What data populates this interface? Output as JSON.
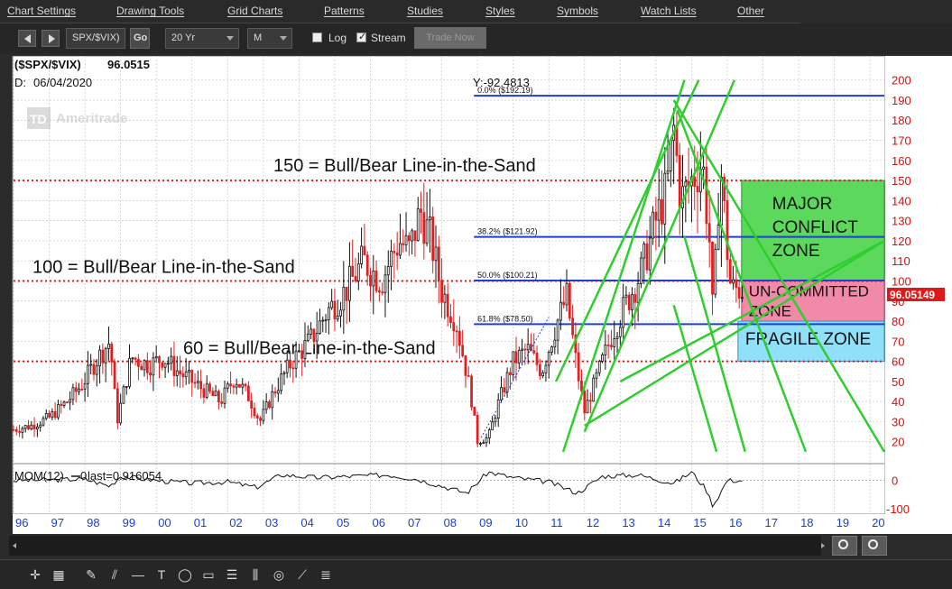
{
  "menu": [
    "Chart Settings",
    "Drawing Tools",
    "Grid Charts",
    "Patterns",
    "Studies",
    "Styles",
    "Symbols",
    "Watch Lists",
    "Other"
  ],
  "toolbar": {
    "symbol": "SPX/$VIX)",
    "go_label": "Go",
    "range": "20 Yr",
    "interval": "M",
    "log_label": "Log",
    "log_checked": false,
    "stream_label": "Stream",
    "stream_checked": true,
    "trade_now_label": "Trade Now"
  },
  "chart_header": {
    "title": "($SPX/$VIX)",
    "last_value": "96.0515",
    "date_label": "D:",
    "date": "06/04/2020",
    "y_readout": "Y:-92.4813",
    "watermark": "Ameritrade",
    "watermark_badge": "TD"
  },
  "chart_data": {
    "type": "line",
    "title": "($SPX/$VIX)",
    "x_ticks": [
      "96",
      "97",
      "98",
      "99",
      "00",
      "01",
      "02",
      "03",
      "04",
      "05",
      "06",
      "07",
      "08",
      "09",
      "10",
      "11",
      "12",
      "13",
      "14",
      "15",
      "16",
      "17",
      "18",
      "19",
      "20"
    ],
    "x_tick_years": [
      1996,
      1997,
      1998,
      1999,
      2000,
      2001,
      2002,
      2003,
      2004,
      2005,
      2006,
      2007,
      2008,
      2009,
      2010,
      2011,
      2012,
      2013,
      2014,
      2015,
      2016,
      2017,
      2018,
      2019,
      2020
    ],
    "y_ticks": [
      20,
      30,
      40,
      50,
      60,
      70,
      80,
      90,
      100,
      110,
      120,
      130,
      140,
      150,
      160,
      170,
      180,
      190,
      200
    ],
    "ylim": [
      10,
      203
    ],
    "xlim": [
      1996.0,
      2020.4
    ],
    "last_value_label": "96.05149",
    "price_series": {
      "name": "$SPX/$VIX",
      "x": [
        1996.0,
        1996.5,
        1997.0,
        1997.5,
        1997.9,
        1998.3,
        1998.7,
        1998.9,
        1999.3,
        1999.8,
        2000.2,
        2000.6,
        2001.0,
        2001.4,
        2001.8,
        2002.2,
        2002.6,
        2002.9,
        2003.3,
        2003.8,
        2004.3,
        2004.8,
        2005.3,
        2005.8,
        2006.3,
        2006.8,
        2007.1,
        2007.4,
        2007.7,
        2008.0,
        2008.4,
        2008.8,
        2009.0,
        2009.3,
        2009.6,
        2010.0,
        2010.4,
        2010.8,
        2011.2,
        2011.5,
        2011.8,
        2012.0,
        2012.4,
        2012.8,
        2013.2,
        2013.6,
        2014.0,
        2014.3,
        2014.5,
        2014.7,
        2015.0,
        2015.3,
        2015.5,
        2015.6,
        2015.8,
        2016.0,
        2016.1
      ],
      "y": [
        26,
        28,
        32,
        40,
        48,
        60,
        70,
        30,
        62,
        58,
        62,
        55,
        50,
        45,
        40,
        52,
        42,
        30,
        45,
        60,
        70,
        85,
        95,
        110,
        100,
        120,
        115,
        135,
        120,
        95,
        80,
        45,
        20,
        22,
        40,
        60,
        66,
        55,
        78,
        92,
        55,
        35,
        55,
        75,
        90,
        105,
        130,
        145,
        175,
        140,
        150,
        160,
        120,
        80,
        160,
        115,
        96
      ]
    },
    "momentum": {
      "label": "MOM(12)",
      "last_label": "last=0.916054",
      "y_ticks": [
        0,
        -100
      ],
      "x": [
        1996.0,
        1997.0,
        1998.0,
        1998.7,
        1999.0,
        2000.0,
        2001.0,
        2002.0,
        2002.8,
        2003.5,
        2004.5,
        2005.5,
        2006.5,
        2007.3,
        2008.0,
        2008.7,
        2009.3,
        2010.0,
        2011.0,
        2011.8,
        2012.5,
        2013.5,
        2014.5,
        2015.0,
        2015.4,
        2015.6,
        2016.0
      ],
      "y": [
        0,
        2,
        5,
        -20,
        15,
        0,
        -10,
        -5,
        -25,
        20,
        10,
        15,
        20,
        5,
        -20,
        -45,
        30,
        10,
        -5,
        -45,
        15,
        20,
        -10,
        30,
        -30,
        -90,
        0
      ]
    },
    "fib_levels": [
      {
        "label": "0.0%",
        "value_label": "($192.19)",
        "y": 192.19
      },
      {
        "label": "38.2%",
        "value_label": "($121.92)",
        "y": 121.92
      },
      {
        "label": "50.0%",
        "value_label": "($100.21)",
        "y": 100.21
      },
      {
        "label": "61.8%",
        "value_label": "($78.50)",
        "y": 78.5
      }
    ],
    "hlines": [
      {
        "y": 150,
        "label": "150 = Bull/Bear Line-in-the-Sand",
        "color": "#d42020"
      },
      {
        "y": 100,
        "label": "100 = Bull/Bear Line-in-the-Sand",
        "color": "#d42020"
      },
      {
        "y": 60,
        "label": "60 = Bull/Bear Line-in-the-Sand",
        "color": "#d42020"
      }
    ],
    "zones": [
      {
        "label_lines": [
          "MAJOR",
          "CONFLICT",
          "ZONE"
        ],
        "y_low": 100,
        "y_high": 150,
        "x_start": 2016.4,
        "color": "#5cd85c"
      },
      {
        "label_lines": [
          "UN-COMMITTED",
          "ZONE"
        ],
        "y_low": 80,
        "y_high": 100,
        "x_start": 2016.4,
        "color": "#f08aa8"
      },
      {
        "label_lines": [
          "FRAGILE ZONE"
        ],
        "y_low": 60,
        "y_high": 80,
        "x_start": 2016.3,
        "color": "#8fe0f8"
      }
    ],
    "trend_lines": [
      {
        "x1": 2011.4,
        "y1": 15,
        "x2": 2014.8,
        "y2": 200
      },
      {
        "x1": 2011.2,
        "y1": 50,
        "x2": 2015.2,
        "y2": 200
      },
      {
        "x1": 2012.0,
        "y1": 25,
        "x2": 2016.2,
        "y2": 200
      },
      {
        "x1": 2012.0,
        "y1": 28,
        "x2": 2020.4,
        "y2": 120
      },
      {
        "x1": 2013.0,
        "y1": 50,
        "x2": 2020.4,
        "y2": 120
      },
      {
        "x1": 2014.5,
        "y1": 190,
        "x2": 2020.4,
        "y2": 15
      },
      {
        "x1": 2014.6,
        "y1": 185,
        "x2": 2018.2,
        "y2": 15
      },
      {
        "x1": 2014.8,
        "y1": 122,
        "x2": 2016.5,
        "y2": 15
      },
      {
        "x1": 2014.5,
        "y1": 88,
        "x2": 2015.7,
        "y2": 15
      }
    ],
    "colors": {
      "up": "#111111",
      "down": "#e02020",
      "grid": "#c8c8c8",
      "axis_text": "#d01010",
      "x_axis_text": "#1a3fd8",
      "fib": "#1f3fd0",
      "trend": "#2fce2f"
    }
  }
}
